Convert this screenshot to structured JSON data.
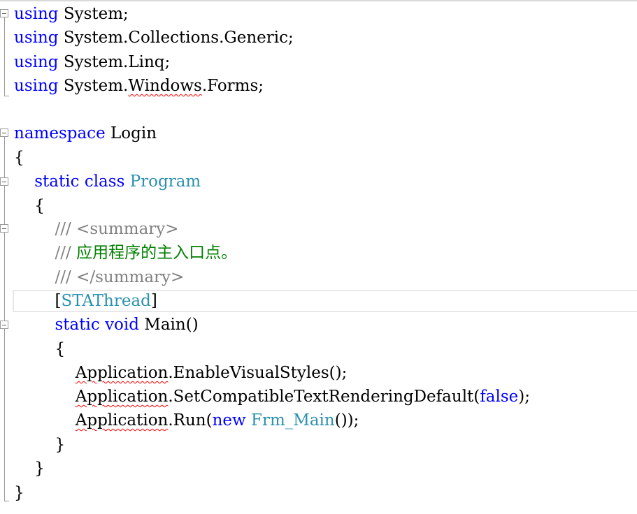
{
  "code": {
    "lines": {
      "l1": {
        "kw": "using",
        "rest": " System;"
      },
      "l2": {
        "kw": "using",
        "rest": " System.Collections.Generic;"
      },
      "l3": {
        "kw": "using",
        "rest": " System.Linq;"
      },
      "l4": {
        "kw": "using",
        "pre": " System.",
        "sq": "Windows",
        "post": ".Forms;"
      },
      "l6": {
        "kw": "namespace",
        "rest": " Login"
      },
      "l7": {
        "text": "{"
      },
      "l8": {
        "indent": "    ",
        "kw1": "static",
        "kw2": "class",
        "type": "Program"
      },
      "l9": {
        "text": "    {"
      },
      "l10": {
        "indent": "        ",
        "c1": "/// ",
        "tag": "<summary>"
      },
      "l11": {
        "indent": "        ",
        "c1": "/// ",
        "ctext": "应用程序的主入口点。"
      },
      "l12": {
        "indent": "        ",
        "c1": "/// ",
        "tag": "</summary>"
      },
      "l13": {
        "indent": "        ",
        "open": "[",
        "type": "STAThread",
        "close": "]"
      },
      "l14": {
        "indent": "        ",
        "kw1": "static",
        "kw2": "void",
        "rest": " Main()"
      },
      "l15": {
        "text": "        {"
      },
      "l16": {
        "indent": "            ",
        "sq": "Application",
        "rest": ".EnableVisualStyles();"
      },
      "l17": {
        "indent": "            ",
        "sq": "Application",
        "pre": ".SetCompatibleTextRenderingDefault(",
        "kw": "false",
        "post": ");"
      },
      "l18": {
        "indent": "            ",
        "sq": "Application",
        "pre": ".Run(",
        "kw": "new",
        "type": "Frm_Main",
        "post": "());"
      },
      "l19": {
        "text": "        }"
      },
      "l20": {
        "text": "    }"
      },
      "l21": {
        "text": "}"
      }
    }
  },
  "colors": {
    "keyword": "#0000ff",
    "type": "#2b91af",
    "comment": "#008000",
    "squiggle": "#ff0000"
  }
}
